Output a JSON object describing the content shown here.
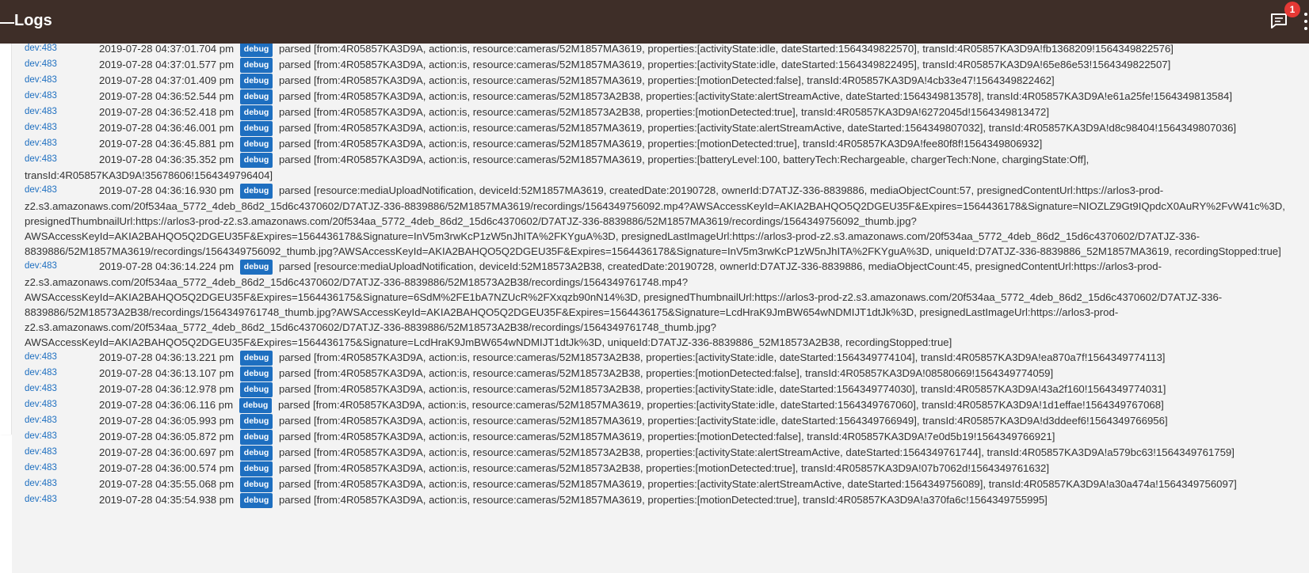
{
  "header": {
    "title": "Logs",
    "notification_count": "1"
  },
  "logs": [
    {
      "source": "dev:483",
      "time": "2019-07-28 04:37:01.704 pm",
      "level": "debug",
      "message": "parsed [from:4R05857KA3D9A, action:is, resource:cameras/52M1857MA3619, properties:[activityState:idle, dateStarted:1564349822570], transId:4R05857KA3D9A!fb1368209!1564349822576]"
    },
    {
      "source": "dev:483",
      "time": "2019-07-28 04:37:01.577 pm",
      "level": "debug",
      "message": "parsed [from:4R05857KA3D9A, action:is, resource:cameras/52M1857MA3619, properties:[activityState:idle, dateStarted:1564349822495], transId:4R05857KA3D9A!65e86e53!1564349822507]"
    },
    {
      "source": "dev:483",
      "time": "2019-07-28 04:37:01.409 pm",
      "level": "debug",
      "message": "parsed [from:4R05857KA3D9A, action:is, resource:cameras/52M1857MA3619, properties:[motionDetected:false], transId:4R05857KA3D9A!4cb33e47!1564349822462]"
    },
    {
      "source": "dev:483",
      "time": "2019-07-28 04:36:52.544 pm",
      "level": "debug",
      "message": "parsed [from:4R05857KA3D9A, action:is, resource:cameras/52M18573A2B38, properties:[activityState:alertStreamActive, dateStarted:1564349813578], transId:4R05857KA3D9A!e61a25fe!1564349813584]"
    },
    {
      "source": "dev:483",
      "time": "2019-07-28 04:36:52.418 pm",
      "level": "debug",
      "message": "parsed [from:4R05857KA3D9A, action:is, resource:cameras/52M18573A2B38, properties:[motionDetected:true], transId:4R05857KA3D9A!6272045d!1564349813472]"
    },
    {
      "source": "dev:483",
      "time": "2019-07-28 04:36:46.001 pm",
      "level": "debug",
      "message": "parsed [from:4R05857KA3D9A, action:is, resource:cameras/52M1857MA3619, properties:[activityState:alertStreamActive, dateStarted:1564349807032], transId:4R05857KA3D9A!d8c98404!1564349807036]"
    },
    {
      "source": "dev:483",
      "time": "2019-07-28 04:36:45.881 pm",
      "level": "debug",
      "message": "parsed [from:4R05857KA3D9A, action:is, resource:cameras/52M1857MA3619, properties:[motionDetected:true], transId:4R05857KA3D9A!fee80f8f!1564349806932]"
    },
    {
      "source": "dev:483",
      "time": "2019-07-28 04:36:35.352 pm",
      "level": "debug",
      "message": "parsed [from:4R05857KA3D9A, action:is, resource:cameras/52M1857MA3619, properties:[batteryLevel:100, batteryTech:Rechargeable, chargerTech:None, chargingState:Off], transId:4R05857KA3D9A!35678606!1564349796404]"
    },
    {
      "source": "dev:483",
      "time": "2019-07-28 04:36:16.930 pm",
      "level": "debug",
      "message": "parsed [resource:mediaUploadNotification, deviceId:52M1857MA3619, createdDate:20190728, ownerId:D7ATJZ-336-8839886, mediaObjectCount:57, presignedContentUrl:https://arlos3-prod-z2.s3.amazonaws.com/20f534aa_5772_4deb_86d2_15d6c4370602/D7ATJZ-336-8839886/52M1857MA3619/recordings/1564349756092.mp4?AWSAccessKeyId=AKIA2BAHQO5Q2DGEU35F&Expires=1564436178&Signature=NIOZLZ9Gt9IQpdcX0AuRY%2FvW41c%3D, presignedThumbnailUrl:https://arlos3-prod-z2.s3.amazonaws.com/20f534aa_5772_4deb_86d2_15d6c4370602/D7ATJZ-336-8839886/52M1857MA3619/recordings/1564349756092_thumb.jpg?AWSAccessKeyId=AKIA2BAHQO5Q2DGEU35F&Expires=1564436178&Signature=InV5m3rwKcP1zW5nJhITA%2FKYguA%3D, presignedLastImageUrl:https://arlos3-prod-z2.s3.amazonaws.com/20f534aa_5772_4deb_86d2_15d6c4370602/D7ATJZ-336-8839886/52M1857MA3619/recordings/1564349756092_thumb.jpg?AWSAccessKeyId=AKIA2BAHQO5Q2DGEU35F&Expires=1564436178&Signature=InV5m3rwKcP1zW5nJhITA%2FKYguA%3D, uniqueId:D7ATJZ-336-8839886_52M1857MA3619, recordingStopped:true]"
    },
    {
      "source": "dev:483",
      "time": "2019-07-28 04:36:14.224 pm",
      "level": "debug",
      "message": "parsed [resource:mediaUploadNotification, deviceId:52M18573A2B38, createdDate:20190728, ownerId:D7ATJZ-336-8839886, mediaObjectCount:45, presignedContentUrl:https://arlos3-prod-z2.s3.amazonaws.com/20f534aa_5772_4deb_86d2_15d6c4370602/D7ATJZ-336-8839886/52M18573A2B38/recordings/1564349761748.mp4?AWSAccessKeyId=AKIA2BAHQO5Q2DGEU35F&Expires=1564436175&Signature=6SdM%2FE1bA7NZUcR%2FXxqzb90nN14%3D, presignedThumbnailUrl:https://arlos3-prod-z2.s3.amazonaws.com/20f534aa_5772_4deb_86d2_15d6c4370602/D7ATJZ-336-8839886/52M18573A2B38/recordings/1564349761748_thumb.jpg?AWSAccessKeyId=AKIA2BAHQO5Q2DGEU35F&Expires=1564436175&Signature=LcdHraK9JmBW654wNDMIJT1dtJk%3D, presignedLastImageUrl:https://arlos3-prod-z2.s3.amazonaws.com/20f534aa_5772_4deb_86d2_15d6c4370602/D7ATJZ-336-8839886/52M18573A2B38/recordings/1564349761748_thumb.jpg?AWSAccessKeyId=AKIA2BAHQO5Q2DGEU35F&Expires=1564436175&Signature=LcdHraK9JmBW654wNDMIJT1dtJk%3D, uniqueId:D7ATJZ-336-8839886_52M18573A2B38, recordingStopped:true]"
    },
    {
      "source": "dev:483",
      "time": "2019-07-28 04:36:13.221 pm",
      "level": "debug",
      "message": "parsed [from:4R05857KA3D9A, action:is, resource:cameras/52M18573A2B38, properties:[activityState:idle, dateStarted:1564349774104], transId:4R05857KA3D9A!ea870a7f!1564349774113]"
    },
    {
      "source": "dev:483",
      "time": "2019-07-28 04:36:13.107 pm",
      "level": "debug",
      "message": "parsed [from:4R05857KA3D9A, action:is, resource:cameras/52M18573A2B38, properties:[motionDetected:false], transId:4R05857KA3D9A!08580669!1564349774059]"
    },
    {
      "source": "dev:483",
      "time": "2019-07-28 04:36:12.978 pm",
      "level": "debug",
      "message": "parsed [from:4R05857KA3D9A, action:is, resource:cameras/52M18573A2B38, properties:[activityState:idle, dateStarted:1564349774030], transId:4R05857KA3D9A!43a2f160!1564349774031]"
    },
    {
      "source": "dev:483",
      "time": "2019-07-28 04:36:06.116 pm",
      "level": "debug",
      "message": "parsed [from:4R05857KA3D9A, action:is, resource:cameras/52M1857MA3619, properties:[activityState:idle, dateStarted:1564349767060], transId:4R05857KA3D9A!1d1effae!1564349767068]"
    },
    {
      "source": "dev:483",
      "time": "2019-07-28 04:36:05.993 pm",
      "level": "debug",
      "message": "parsed [from:4R05857KA3D9A, action:is, resource:cameras/52M1857MA3619, properties:[activityState:idle, dateStarted:1564349766949], transId:4R05857KA3D9A!d3ddeef6!1564349766956]"
    },
    {
      "source": "dev:483",
      "time": "2019-07-28 04:36:05.872 pm",
      "level": "debug",
      "message": "parsed [from:4R05857KA3D9A, action:is, resource:cameras/52M1857MA3619, properties:[motionDetected:false], transId:4R05857KA3D9A!7e0d5b19!1564349766921]"
    },
    {
      "source": "dev:483",
      "time": "2019-07-28 04:36:00.697 pm",
      "level": "debug",
      "message": "parsed [from:4R05857KA3D9A, action:is, resource:cameras/52M18573A2B38, properties:[activityState:alertStreamActive, dateStarted:1564349761744], transId:4R05857KA3D9A!a579bc63!1564349761759]"
    },
    {
      "source": "dev:483",
      "time": "2019-07-28 04:36:00.574 pm",
      "level": "debug",
      "message": "parsed [from:4R05857KA3D9A, action:is, resource:cameras/52M18573A2B38, properties:[motionDetected:true], transId:4R05857KA3D9A!07b7062d!1564349761632]"
    },
    {
      "source": "dev:483",
      "time": "2019-07-28 04:35:55.068 pm",
      "level": "debug",
      "message": "parsed [from:4R05857KA3D9A, action:is, resource:cameras/52M1857MA3619, properties:[activityState:alertStreamActive, dateStarted:1564349756089], transId:4R05857KA3D9A!a30a474a!1564349756097]"
    },
    {
      "source": "dev:483",
      "time": "2019-07-28 04:35:54.938 pm",
      "level": "debug",
      "message": "parsed [from:4R05857KA3D9A, action:is, resource:cameras/52M1857MA3619, properties:[motionDetected:true], transId:4R05857KA3D9A!a370fa6c!1564349755995]"
    }
  ],
  "colors": {
    "topbar": "#3e2e28",
    "link": "#1e6fc0",
    "debug_badge": "#1e6fc0",
    "notification_badge": "#e53935",
    "log_background": "#f3f3f3"
  }
}
